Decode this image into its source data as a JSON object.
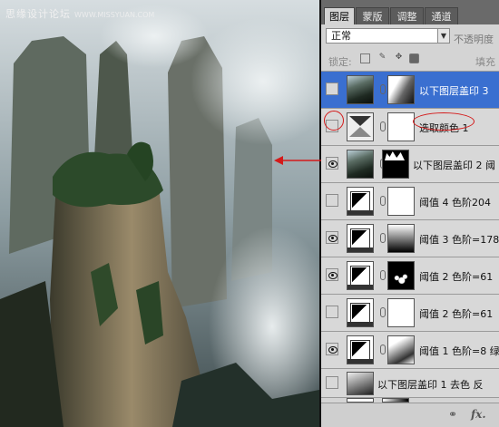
{
  "watermark": {
    "text": "思缘设计论坛",
    "url": "WWW.MISSYUAN.COM"
  },
  "layers_panel": {
    "tabs": [
      {
        "label": "图层",
        "active": true
      },
      {
        "label": "蒙版",
        "active": false
      },
      {
        "label": "调整",
        "active": false
      },
      {
        "label": "通道",
        "active": false
      }
    ],
    "blend_mode": "正常",
    "opacity_label": "不透明度",
    "lock_label": "锁定:",
    "fill_label": "填充",
    "layers": [
      {
        "name": "以下图层盖印 3",
        "visible": false,
        "selected": true
      },
      {
        "name": "选取颜色 1",
        "visible": false,
        "selected": false
      },
      {
        "name": "以下图层盖印 2  阈",
        "visible": true,
        "selected": false
      },
      {
        "name": "阈值 4 色阶204",
        "visible": false,
        "selected": false
      },
      {
        "name": "阈值 3 色阶=178",
        "visible": true,
        "selected": false
      },
      {
        "name": "阈值 2  色阶=61",
        "visible": true,
        "selected": false
      },
      {
        "name": "阈值 2 色阶=61",
        "visible": false,
        "selected": false
      },
      {
        "name": "阈值 1 色阶=8  绿",
        "visible": true,
        "selected": false
      },
      {
        "name": "以下图层盖印 1   去色  反",
        "visible": false,
        "selected": false
      }
    ],
    "footer_icons": [
      "link-icon",
      "fx-icon"
    ]
  },
  "colors": {
    "selection": "#3a6fd0",
    "annotation": "#d41a1a",
    "panel": "#d4d4d4"
  }
}
